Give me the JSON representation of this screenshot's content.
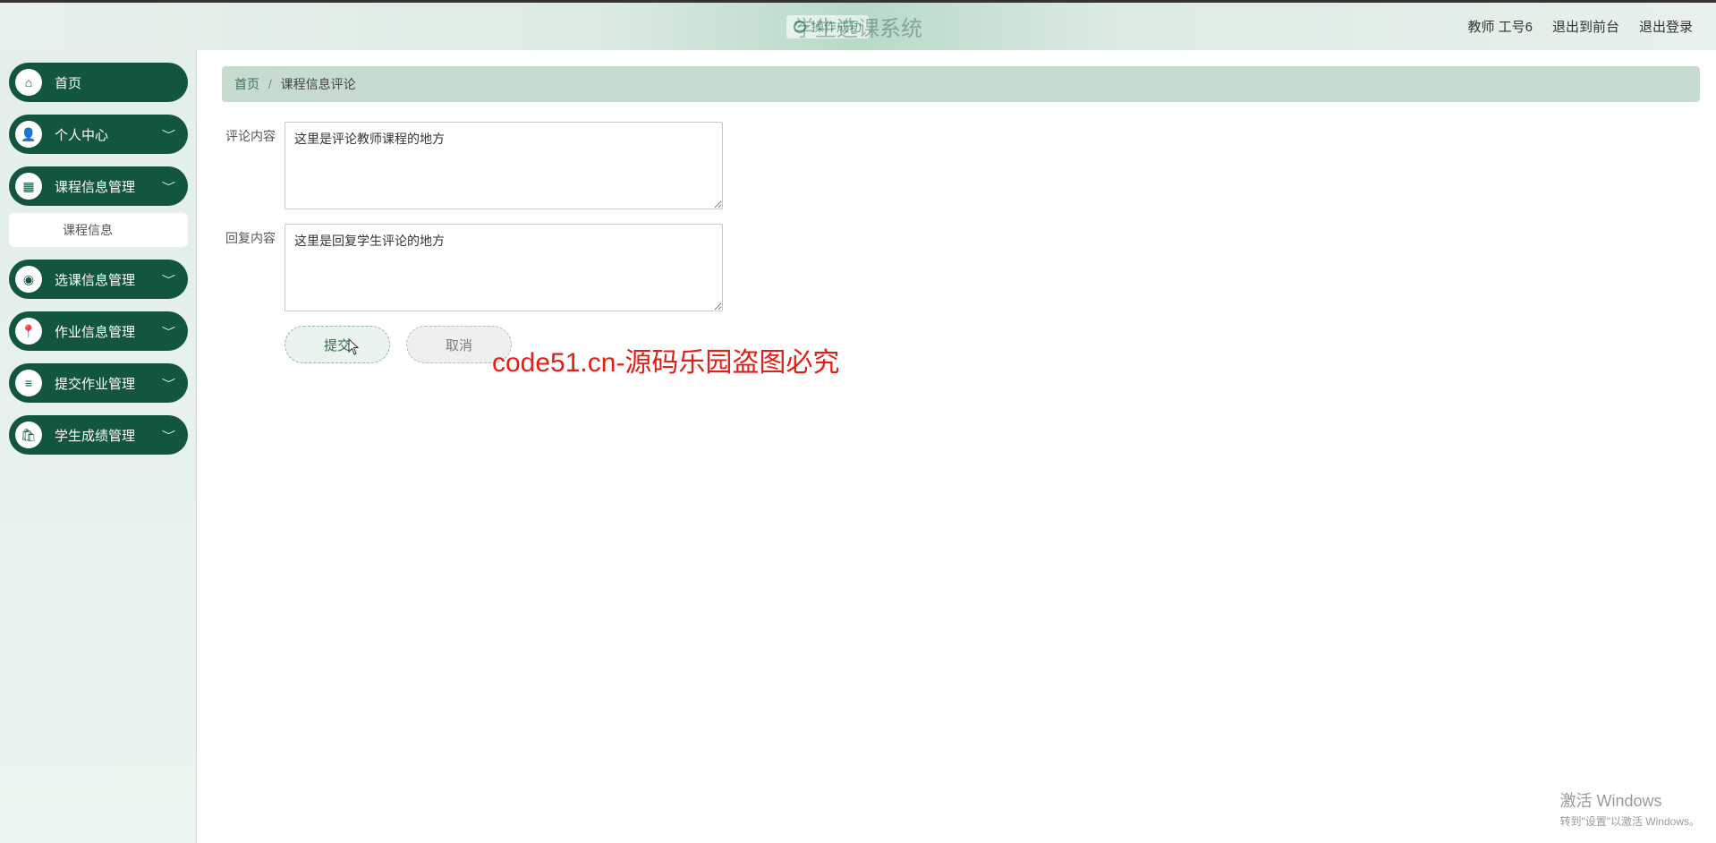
{
  "watermark": "code51.cn",
  "header": {
    "system_title": "学生选课系统",
    "success_msg": "操作成功",
    "user_label": "教师 工号6",
    "exit_front": "退出到前台",
    "logout": "退出登录"
  },
  "sidebar": {
    "items": [
      {
        "label": "首页",
        "has_chev": false
      },
      {
        "label": "个人中心",
        "has_chev": true
      },
      {
        "label": "课程信息管理",
        "has_chev": true,
        "sub": [
          "课程信息"
        ]
      },
      {
        "label": "选课信息管理",
        "has_chev": true
      },
      {
        "label": "作业信息管理",
        "has_chev": true
      },
      {
        "label": "提交作业管理",
        "has_chev": true
      },
      {
        "label": "学生成绩管理",
        "has_chev": true
      }
    ]
  },
  "breadcrumb": {
    "home": "首页",
    "current": "课程信息评论"
  },
  "form": {
    "comment_label": "评论内容",
    "comment_value": "这里是评论教师课程的地方",
    "reply_label": "回复内容",
    "reply_value": "这里是回复学生评论的地方",
    "submit": "提交",
    "cancel": "取消"
  },
  "overlay_red": "code51.cn-源码乐园盗图必究",
  "windows": {
    "line1": "激活 Windows",
    "line2": "转到\"设置\"以激活 Windows。"
  },
  "icons": {
    "home": "⌂",
    "user": "👤",
    "grid": "▦",
    "disc": "◉",
    "pin": "📍",
    "list": "≡",
    "bag": "🛍"
  }
}
